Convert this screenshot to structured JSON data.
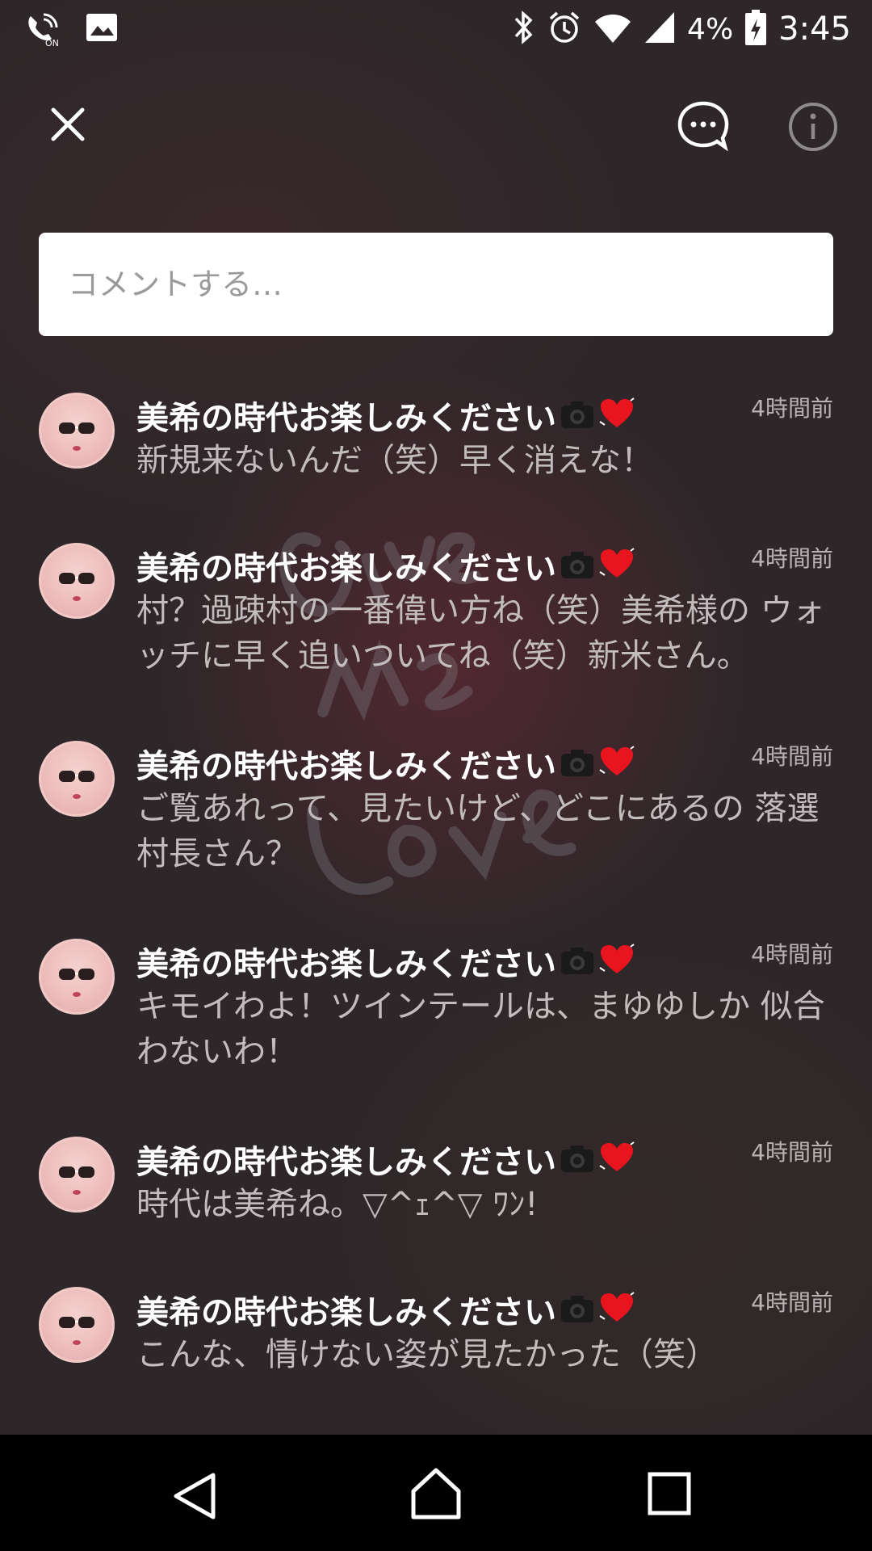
{
  "status_bar": {
    "battery_percent": "4%",
    "time": "3:45"
  },
  "top_bar": {
    "close_icon": "close-icon",
    "chat_icon": "chat-bubble-icon",
    "info_icon": "info-icon"
  },
  "comment_box": {
    "placeholder": "コメントする…"
  },
  "comments": [
    {
      "name": "美希の時代お楽しみください",
      "time": "4時間前",
      "text": "新規来ないんだ（笑）早く消えな！"
    },
    {
      "name": "美希の時代お楽しみください",
      "time": "4時間前",
      "text": "村？過疎村の一番偉い方ね（笑）美希様の ウォッチに早く追いついてね（笑）新米さん。"
    },
    {
      "name": "美希の時代お楽しみください",
      "time": "4時間前",
      "text": "ご覧あれって、見たいけど、どこにあるの 落選村長さん？"
    },
    {
      "name": "美希の時代お楽しみください",
      "time": "4時間前",
      "text": "キモイわよ！ツインテールは、まゆゆしか 似合わないわ！"
    },
    {
      "name": "美希の時代お楽しみください",
      "time": "4時間前",
      "text": "時代は美希ね。▽^ｪ^▽ ﾜﾝ!"
    },
    {
      "name": "美希の時代お楽しみください",
      "time": "4時間前",
      "text": "こんな、情けない姿が見たかった（笑）"
    }
  ],
  "colors": {
    "accent_heart": "#e8141e",
    "name_text": "#ffffff",
    "comment_text": "#c2bcbd"
  }
}
